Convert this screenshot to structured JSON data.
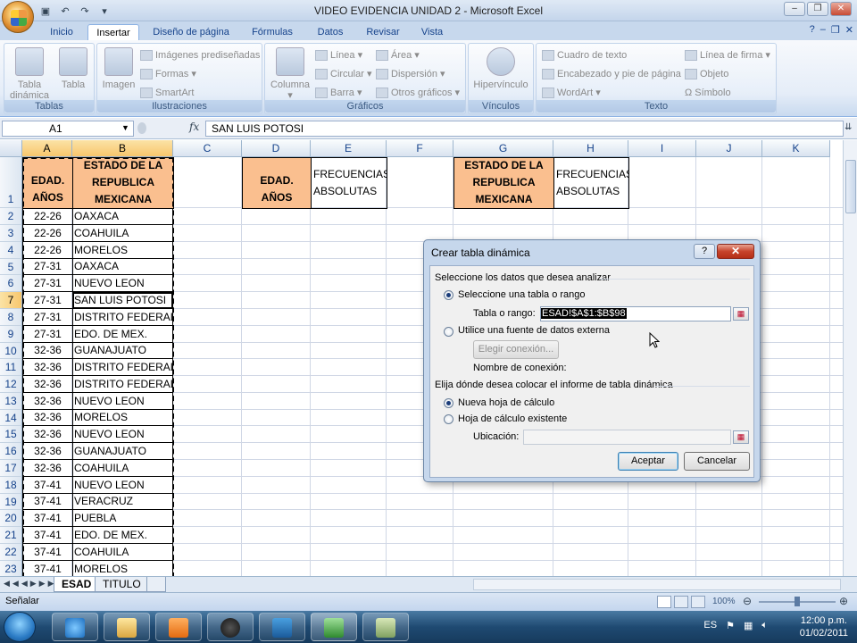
{
  "window": {
    "title": "VIDEO EVIDENCIA UNIDAD 2 - Microsoft Excel"
  },
  "tabs": [
    "Inicio",
    "Insertar",
    "Diseño de página",
    "Fórmulas",
    "Datos",
    "Revisar",
    "Vista"
  ],
  "ribbon": {
    "tablas": {
      "label": "Tablas",
      "pivot": "Tabla dinámica",
      "table": "Tabla"
    },
    "ilustraciones": {
      "label": "Ilustraciones",
      "imagen": "Imagen",
      "prediseñadas": "Imágenes prediseñadas",
      "formas": "Formas",
      "smartart": "SmartArt"
    },
    "graficos": {
      "label": "Gráficos",
      "columna": "Columna",
      "linea": "Línea",
      "circular": "Circular",
      "barra": "Barra",
      "area": "Área",
      "dispersion": "Dispersión",
      "otros": "Otros gráficos"
    },
    "vinculos": {
      "label": "Vínculos",
      "hipervinculo": "Hipervínculo"
    },
    "texto": {
      "label": "Texto",
      "cuadro": "Cuadro de texto",
      "encabezado": "Encabezado y pie de página",
      "wordart": "WordArt",
      "firma": "Línea de firma",
      "objeto": "Objeto",
      "simbolo": "Símbolo"
    }
  },
  "formula_bar": {
    "name_box": "A1",
    "fx": "fx",
    "value": "SAN LUIS POTOSI"
  },
  "columns": [
    "A",
    "B",
    "C",
    "D",
    "E",
    "F",
    "G",
    "H",
    "I",
    "J",
    "K"
  ],
  "header_row": {
    "a": [
      "EDAD.",
      "AÑOS"
    ],
    "b": [
      "ESTADO DE  LA",
      "REPUBLICA",
      "MEXICANA"
    ],
    "d": [
      "EDAD.",
      "AÑOS"
    ],
    "e": [
      "FRECUENCIAS",
      "ABSOLUTAS"
    ],
    "g": [
      "ESTADO DE  LA",
      "REPUBLICA",
      "MEXICANA"
    ],
    "h": [
      "FRECUENCIAS",
      "ABSOLUTAS"
    ]
  },
  "rows": [
    {
      "n": "1"
    },
    {
      "n": "2",
      "a": "22-26",
      "b": "OAXACA"
    },
    {
      "n": "3",
      "a": "22-26",
      "b": "COAHUILA"
    },
    {
      "n": "4",
      "a": "22-26",
      "b": "MORELOS"
    },
    {
      "n": "5",
      "a": "27-31",
      "b": "OAXACA"
    },
    {
      "n": "6",
      "a": "27-31",
      "b": "NUEVO LEON"
    },
    {
      "n": "7",
      "a": "27-31",
      "b": "SAN LUIS POTOSI"
    },
    {
      "n": "8",
      "a": "27-31",
      "b": "DISTRITO FEDERAL"
    },
    {
      "n": "9",
      "a": "27-31",
      "b": "EDO. DE MEX."
    },
    {
      "n": "10",
      "a": "32-36",
      "b": "GUANAJUATO"
    },
    {
      "n": "11",
      "a": "32-36",
      "b": "DISTRITO FEDERAL"
    },
    {
      "n": "12",
      "a": "32-36",
      "b": "DISTRITO FEDERAL"
    },
    {
      "n": "13",
      "a": "32-36",
      "b": "NUEVO LEON"
    },
    {
      "n": "14",
      "a": "32-36",
      "b": "MORELOS"
    },
    {
      "n": "15",
      "a": "32-36",
      "b": "NUEVO LEON"
    },
    {
      "n": "16",
      "a": "32-36",
      "b": "GUANAJUATO"
    },
    {
      "n": "17",
      "a": "32-36",
      "b": "COAHUILA"
    },
    {
      "n": "18",
      "a": "37-41",
      "b": "NUEVO LEON"
    },
    {
      "n": "19",
      "a": "37-41",
      "b": "VERACRUZ"
    },
    {
      "n": "20",
      "a": "37-41",
      "b": "PUEBLA"
    },
    {
      "n": "21",
      "a": "37-41",
      "b": "EDO. DE MEX."
    },
    {
      "n": "22",
      "a": "37-41",
      "b": "COAHUILA"
    },
    {
      "n": "23",
      "a": "37-41",
      "b": "MORELOS"
    }
  ],
  "sheets": {
    "active": "ESAD",
    "other": "TITULO"
  },
  "status": {
    "mode": "Señalar",
    "zoom": "100%"
  },
  "dialog": {
    "title": "Crear tabla dinámica",
    "help": "?",
    "close": "✕",
    "section1": "Seleccione los datos que desea analizar",
    "opt_range": "Seleccione una tabla o rango",
    "range_label": "Tabla o rango:",
    "range_value": "ESAD!$A$1:$B$98",
    "opt_external": "Utilice una fuente de datos externa",
    "choose_conn": "Elegir conexión...",
    "conn_name": "Nombre de conexión:",
    "section2": "Elija dónde desea colocar el informe de tabla dinámica",
    "opt_new": "Nueva hoja de cálculo",
    "opt_existing": "Hoja de cálculo existente",
    "location": "Ubicación:",
    "ok": "Aceptar",
    "cancel": "Cancelar"
  },
  "taskbar": {
    "lang": "ES",
    "time": "12:00 p.m.",
    "date": "01/02/2011"
  }
}
